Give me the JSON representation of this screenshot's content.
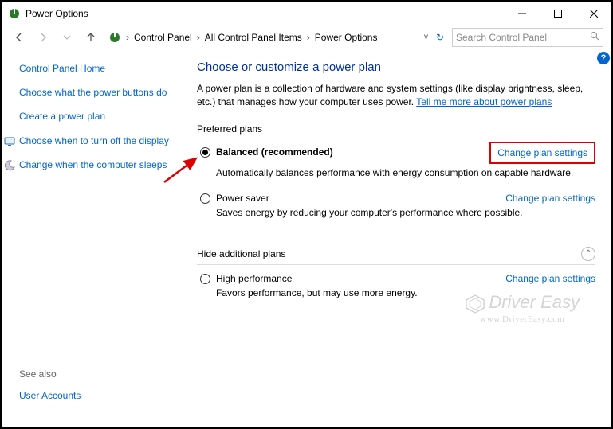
{
  "title": "Power Options",
  "breadcrumb": {
    "seg1": "Control Panel",
    "seg2": "All Control Panel Items",
    "seg3": "Power Options"
  },
  "search": {
    "placeholder": "Search Control Panel"
  },
  "sidebar": {
    "home": "Control Panel Home",
    "buttons": "Choose what the power buttons do",
    "create": "Create a power plan",
    "turnoff": "Choose when to turn off the display",
    "sleeps": "Change when the computer sleeps"
  },
  "main": {
    "heading": "Choose or customize a power plan",
    "intro_pre": "A power plan is a collection of hardware and system settings (like display brightness, sleep, etc.) that manages how your computer uses power. ",
    "intro_link": "Tell me more about power plans",
    "preferred_label": "Preferred plans",
    "hide_label": "Hide additional plans"
  },
  "plans": {
    "balanced": {
      "name": "Balanced (recommended)",
      "desc": "Automatically balances performance with energy consumption on capable hardware.",
      "change": "Change plan settings"
    },
    "saver": {
      "name": "Power saver",
      "desc": "Saves energy by reducing your computer's performance where possible.",
      "change": "Change plan settings"
    },
    "high": {
      "name": "High performance",
      "desc": "Favors performance, but may use more energy.",
      "change": "Change plan settings"
    }
  },
  "seealso": {
    "label": "See also",
    "users": "User Accounts"
  },
  "watermark": {
    "brand": "Driver Easy",
    "url": "www.DriverEasy.com"
  }
}
